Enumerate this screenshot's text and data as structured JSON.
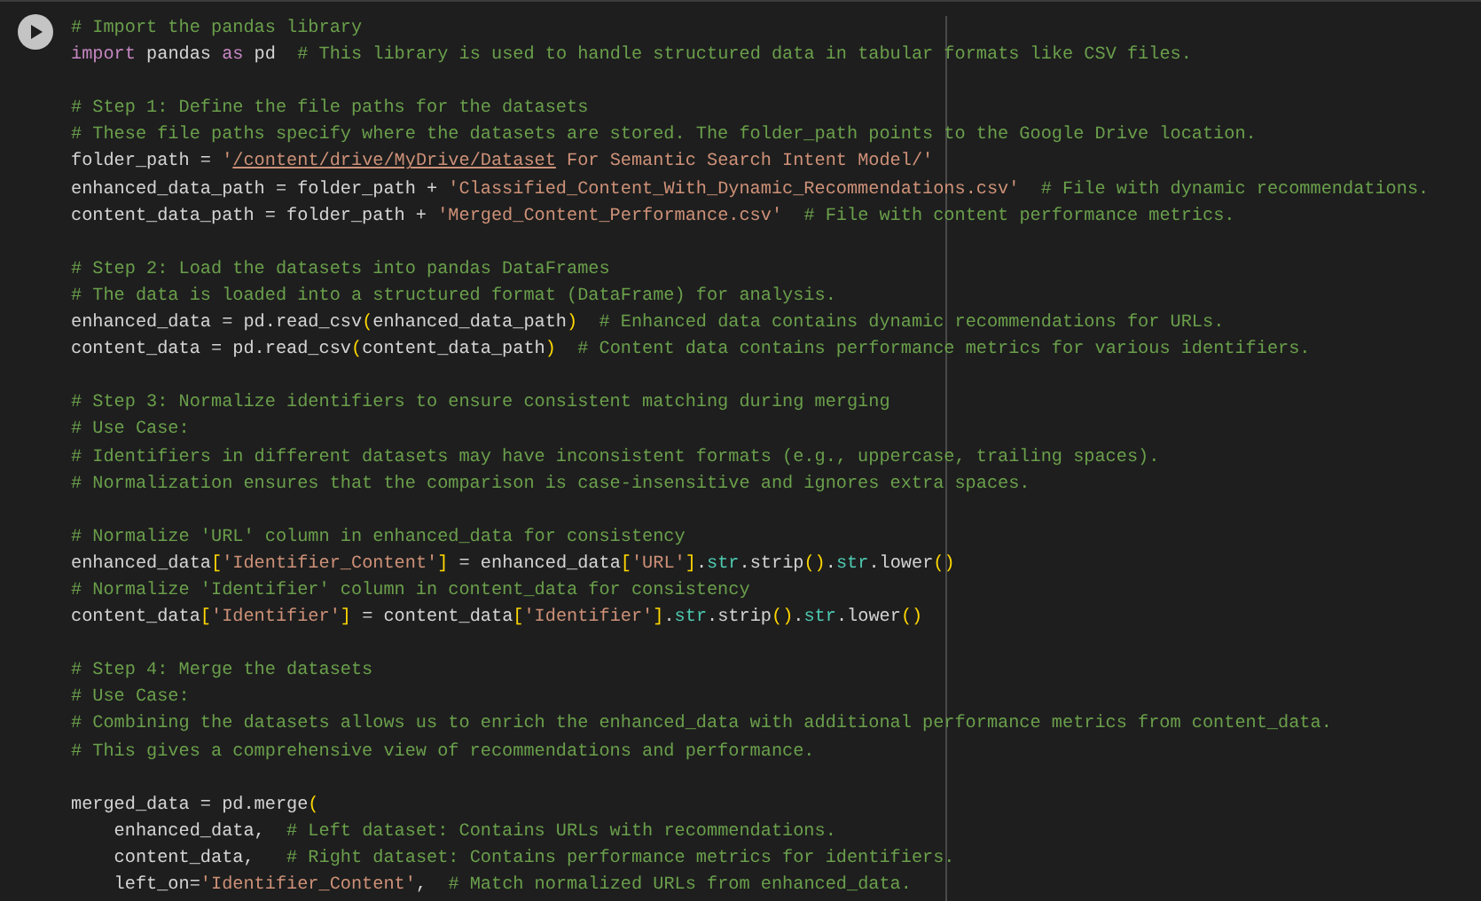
{
  "cell": {
    "running": false,
    "lines": [
      {
        "kind": "code",
        "segments": [
          {
            "kind": "comment",
            "text": "# Import the pandas library"
          }
        ]
      },
      {
        "kind": "code",
        "segments": [
          {
            "kind": "keyword",
            "text": "import"
          },
          {
            "kind": "plain",
            "text": " pandas "
          },
          {
            "kind": "keyword",
            "text": "as"
          },
          {
            "kind": "plain",
            "text": " pd  "
          },
          {
            "kind": "comment",
            "text": "# This library is used to handle structured data in tabular formats like CSV files."
          }
        ]
      },
      {
        "kind": "blank"
      },
      {
        "kind": "code",
        "segments": [
          {
            "kind": "comment",
            "text": "# Step 1: Define the file paths for the datasets"
          }
        ]
      },
      {
        "kind": "code",
        "segments": [
          {
            "kind": "comment",
            "text": "# These file paths specify where the datasets are stored. The folder_path points to the Google Drive location."
          }
        ]
      },
      {
        "kind": "code",
        "segments": [
          {
            "kind": "plain",
            "text": "folder_path = "
          },
          {
            "kind": "string",
            "text": "'"
          },
          {
            "kind": "link",
            "text": "/content/drive/MyDrive/Dataset"
          },
          {
            "kind": "string",
            "text": " For Semantic Search Intent Model/'"
          }
        ]
      },
      {
        "kind": "code",
        "segments": [
          {
            "kind": "plain",
            "text": "enhanced_data_path = folder_path + "
          },
          {
            "kind": "string",
            "text": "'Classified_Content_With_Dynamic_Recommendations.csv'  "
          },
          {
            "kind": "comment",
            "text": "# File with dynamic recommendations."
          }
        ]
      },
      {
        "kind": "code",
        "segments": [
          {
            "kind": "plain",
            "text": "content_data_path = folder_path + "
          },
          {
            "kind": "string",
            "text": "'Merged_Content_Performance.csv'  "
          },
          {
            "kind": "comment",
            "text": "# File with content performance metrics."
          }
        ]
      },
      {
        "kind": "blank"
      },
      {
        "kind": "code",
        "segments": [
          {
            "kind": "comment",
            "text": "# Step 2: Load the datasets into pandas DataFrames"
          }
        ]
      },
      {
        "kind": "code",
        "segments": [
          {
            "kind": "comment",
            "text": "# The data is loaded into a structured format (DataFrame) for analysis."
          }
        ]
      },
      {
        "kind": "code",
        "segments": [
          {
            "kind": "plain",
            "text": "enhanced_data = pd.read_csv"
          },
          {
            "kind": "bracket",
            "text": "("
          },
          {
            "kind": "plain",
            "text": "enhanced_data_path"
          },
          {
            "kind": "bracket",
            "text": ")  "
          },
          {
            "kind": "comment",
            "text": "# Enhanced data contains dynamic recommendations for URLs."
          }
        ]
      },
      {
        "kind": "code",
        "segments": [
          {
            "kind": "plain",
            "text": "content_data = pd.read_csv"
          },
          {
            "kind": "bracket",
            "text": "("
          },
          {
            "kind": "plain",
            "text": "content_data_path"
          },
          {
            "kind": "bracket",
            "text": ")  "
          },
          {
            "kind": "comment",
            "text": "# Content data contains performance metrics for various identifiers."
          }
        ]
      },
      {
        "kind": "blank"
      },
      {
        "kind": "code",
        "segments": [
          {
            "kind": "comment",
            "text": "# Step 3: Normalize identifiers to ensure consistent matching during merging"
          }
        ]
      },
      {
        "kind": "code",
        "segments": [
          {
            "kind": "comment",
            "text": "# Use Case:"
          }
        ]
      },
      {
        "kind": "code",
        "segments": [
          {
            "kind": "comment",
            "text": "# Identifiers in different datasets may have inconsistent formats (e.g., uppercase, trailing spaces)."
          }
        ]
      },
      {
        "kind": "code",
        "segments": [
          {
            "kind": "comment",
            "text": "# Normalization ensures that the comparison is case-insensitive and ignores extra spaces."
          }
        ]
      },
      {
        "kind": "blank"
      },
      {
        "kind": "code",
        "segments": [
          {
            "kind": "comment",
            "text": "# Normalize 'URL' column in enhanced_data for consistency"
          }
        ]
      },
      {
        "kind": "code",
        "segments": [
          {
            "kind": "plain",
            "text": "enhanced_data"
          },
          {
            "kind": "bracket",
            "text": "["
          },
          {
            "kind": "string",
            "text": "'Identifier_Content'"
          },
          {
            "kind": "bracket",
            "text": "]"
          },
          {
            "kind": "plain",
            "text": " = enhanced_data"
          },
          {
            "kind": "bracket",
            "text": "["
          },
          {
            "kind": "string",
            "text": "'URL'"
          },
          {
            "kind": "bracket",
            "text": "]"
          },
          {
            "kind": "plain",
            "text": "."
          },
          {
            "kind": "attribute",
            "text": "str"
          },
          {
            "kind": "plain",
            "text": ".strip"
          },
          {
            "kind": "bracket",
            "text": "()"
          },
          {
            "kind": "plain",
            "text": "."
          },
          {
            "kind": "attribute",
            "text": "str"
          },
          {
            "kind": "plain",
            "text": ".lower"
          },
          {
            "kind": "bracket",
            "text": "()"
          }
        ]
      },
      {
        "kind": "code",
        "segments": [
          {
            "kind": "comment",
            "text": "# Normalize 'Identifier' column in content_data for consistency"
          }
        ]
      },
      {
        "kind": "code",
        "segments": [
          {
            "kind": "plain",
            "text": "content_data"
          },
          {
            "kind": "bracket",
            "text": "["
          },
          {
            "kind": "string",
            "text": "'Identifier'"
          },
          {
            "kind": "bracket",
            "text": "]"
          },
          {
            "kind": "plain",
            "text": " = content_data"
          },
          {
            "kind": "bracket",
            "text": "["
          },
          {
            "kind": "string",
            "text": "'Identifier'"
          },
          {
            "kind": "bracket",
            "text": "]"
          },
          {
            "kind": "plain",
            "text": "."
          },
          {
            "kind": "attribute",
            "text": "str"
          },
          {
            "kind": "plain",
            "text": ".strip"
          },
          {
            "kind": "bracket",
            "text": "()"
          },
          {
            "kind": "plain",
            "text": "."
          },
          {
            "kind": "attribute",
            "text": "str"
          },
          {
            "kind": "plain",
            "text": ".lower"
          },
          {
            "kind": "bracket",
            "text": "()"
          }
        ]
      },
      {
        "kind": "blank"
      },
      {
        "kind": "code",
        "segments": [
          {
            "kind": "comment",
            "text": "# Step 4: Merge the datasets"
          }
        ]
      },
      {
        "kind": "code",
        "segments": [
          {
            "kind": "comment",
            "text": "# Use Case:"
          }
        ]
      },
      {
        "kind": "code",
        "segments": [
          {
            "kind": "comment",
            "text": "# Combining the datasets allows us to enrich the enhanced_data with additional performance metrics from content_data."
          }
        ]
      },
      {
        "kind": "code",
        "segments": [
          {
            "kind": "comment",
            "text": "# This gives a comprehensive view of recommendations and performance."
          }
        ]
      },
      {
        "kind": "blank"
      },
      {
        "kind": "code",
        "segments": [
          {
            "kind": "plain",
            "text": "merged_data = pd.merge"
          },
          {
            "kind": "bracket",
            "text": "("
          }
        ]
      },
      {
        "kind": "code",
        "segments": [
          {
            "kind": "plain",
            "text": "    enhanced_data,  "
          },
          {
            "kind": "comment",
            "text": "# Left dataset: Contains URLs with recommendations."
          }
        ]
      },
      {
        "kind": "code",
        "segments": [
          {
            "kind": "plain",
            "text": "    content_data,   "
          },
          {
            "kind": "comment",
            "text": "# Right dataset: Contains performance metrics for identifiers."
          }
        ]
      },
      {
        "kind": "code",
        "segments": [
          {
            "kind": "plain",
            "text": "    left_on="
          },
          {
            "kind": "string",
            "text": "'Identifier_Content'"
          },
          {
            "kind": "plain",
            "text": ",  "
          },
          {
            "kind": "comment",
            "text": "# Match normalized URLs from enhanced_data."
          }
        ]
      }
    ]
  }
}
